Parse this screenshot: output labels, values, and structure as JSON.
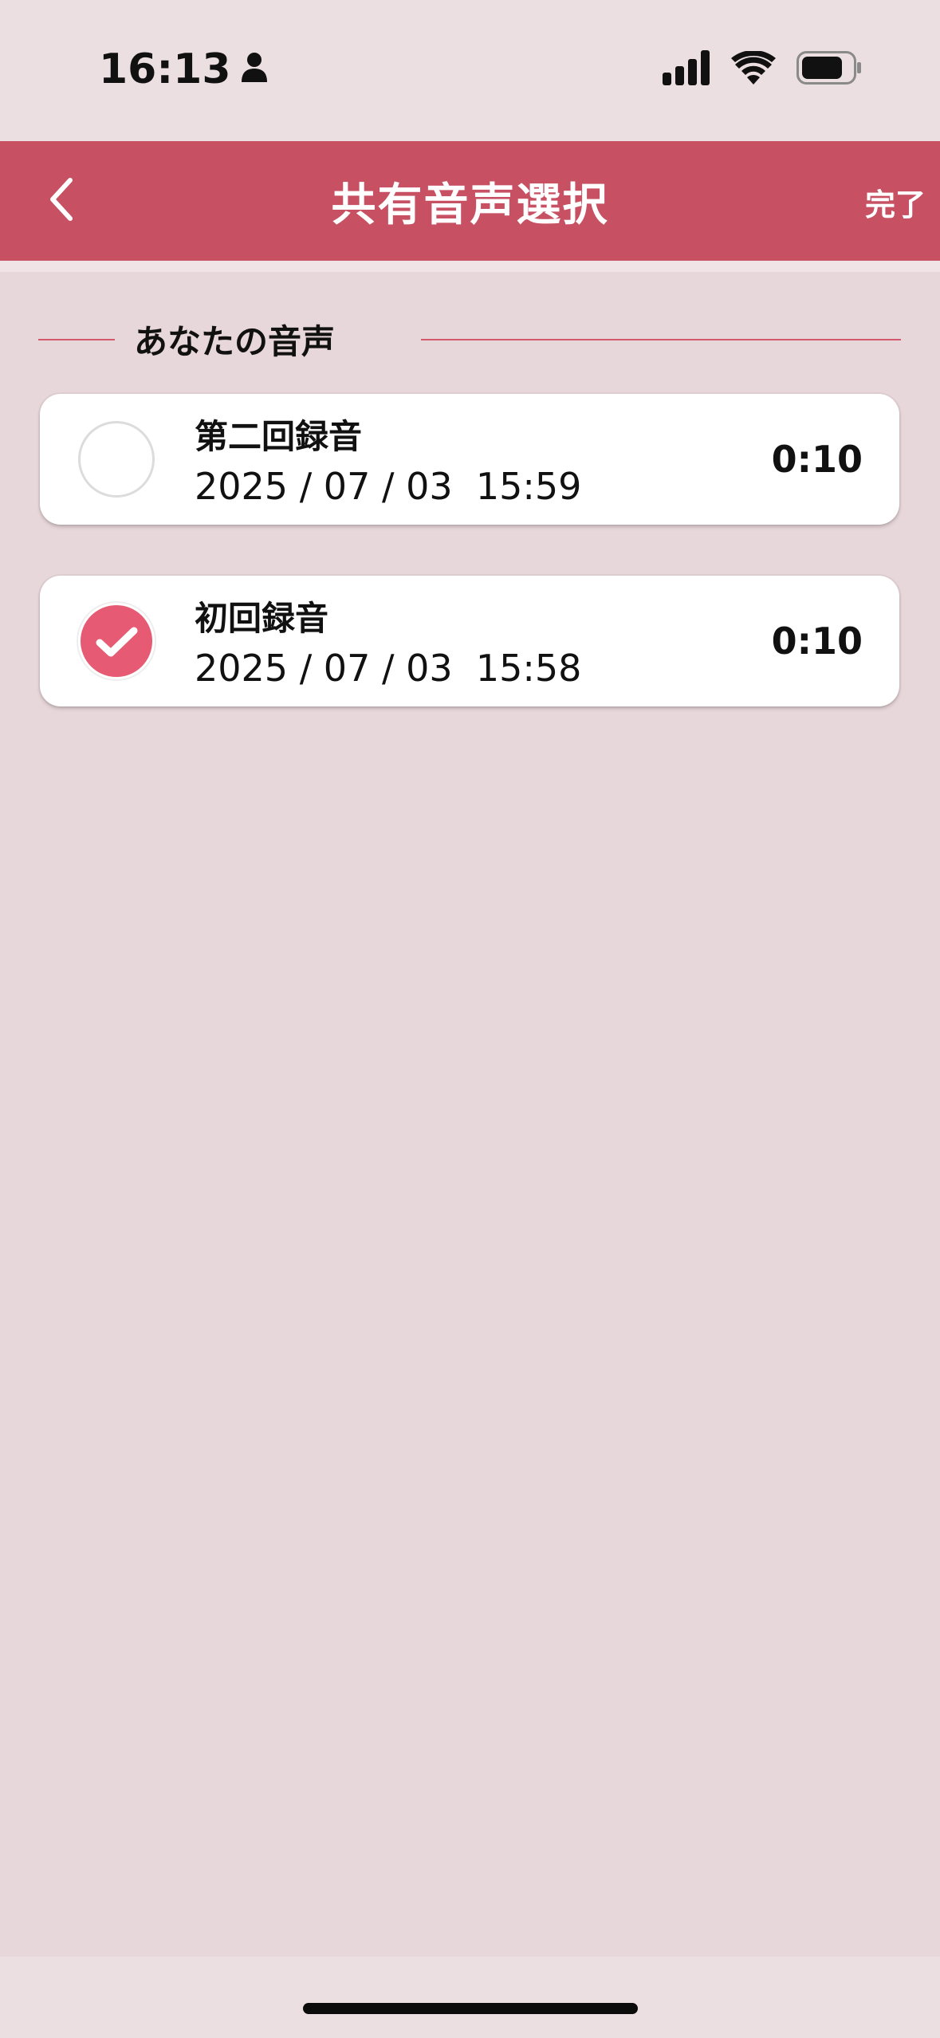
{
  "status_bar": {
    "time": "16:13",
    "icons": [
      "person-icon",
      "signal-icon",
      "wifi-icon",
      "battery-icon"
    ]
  },
  "header": {
    "title": "共有音声選択",
    "back_icon": "chevron-left-icon",
    "done_label": "完了",
    "background_color": "#c75063"
  },
  "section": {
    "title": "あなたの音声"
  },
  "recordings": [
    {
      "name": "第二回録音",
      "date": "2025 / 07 / 03  15:59",
      "duration": "0:10",
      "selected": false
    },
    {
      "name": "初回録音",
      "date": "2025 / 07 / 03  15:58",
      "duration": "0:10",
      "selected": true
    }
  ],
  "colors": {
    "accent": "#e65a73",
    "background": "#e8d7da"
  }
}
